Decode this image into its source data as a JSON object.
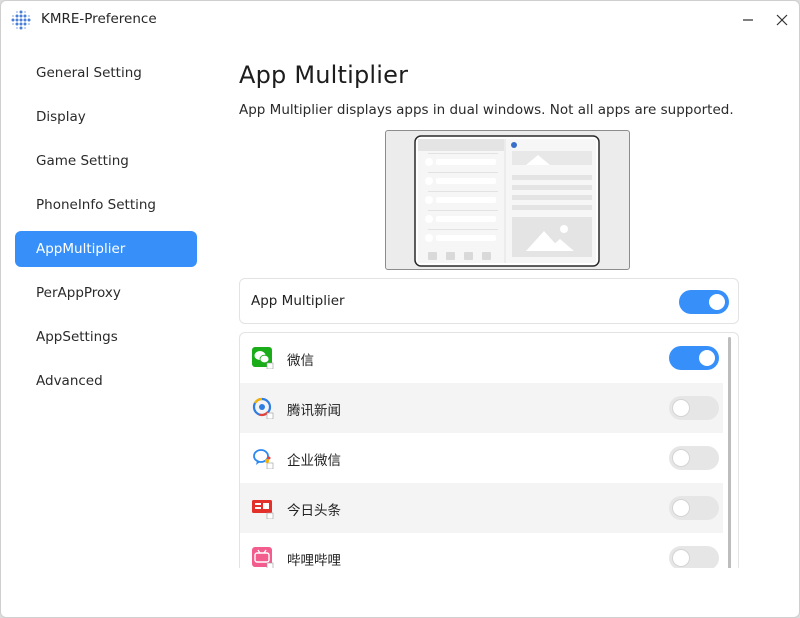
{
  "window": {
    "title": "KMRE-Preference"
  },
  "sidebar": {
    "items": [
      {
        "label": "General Setting",
        "active": false
      },
      {
        "label": "Display",
        "active": false
      },
      {
        "label": "Game Setting",
        "active": false
      },
      {
        "label": "PhoneInfo Setting",
        "active": false
      },
      {
        "label": "AppMultiplier",
        "active": true
      },
      {
        "label": "PerAppProxy",
        "active": false
      },
      {
        "label": "AppSettings",
        "active": false
      },
      {
        "label": "Advanced",
        "active": false
      }
    ]
  },
  "main": {
    "title": "App Multiplier",
    "description": "App Multiplier displays apps in dual windows. Not all apps are supported.",
    "master_toggle": {
      "label": "App Multiplier",
      "enabled": true
    },
    "apps": [
      {
        "name": "微信",
        "icon": "wechat-icon",
        "enabled": true
      },
      {
        "name": "腾讯新闻",
        "icon": "tencent-news-icon",
        "enabled": false
      },
      {
        "name": "企业微信",
        "icon": "wecom-icon",
        "enabled": false
      },
      {
        "name": "今日头条",
        "icon": "toutiao-icon",
        "enabled": false
      },
      {
        "name": "哔哩哔哩",
        "icon": "bilibili-icon",
        "enabled": false
      }
    ]
  },
  "colors": {
    "accent": "#3790fa",
    "toggle_off": "#e6e6e6"
  }
}
